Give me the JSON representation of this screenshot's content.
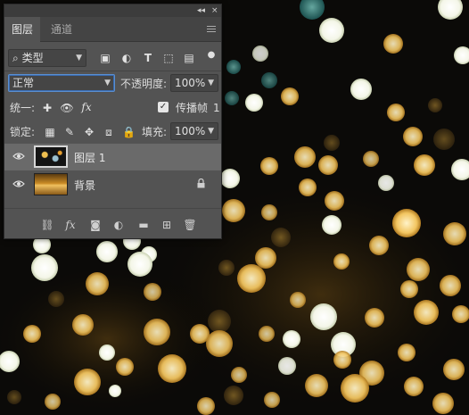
{
  "panel": {
    "collapse_icon": "collapse-double-arrow-icon",
    "close_label": "×",
    "tabs": [
      {
        "label": "图层",
        "active": true
      },
      {
        "label": "通道",
        "active": false
      }
    ]
  },
  "filter": {
    "kind_label": "类型",
    "icons": [
      "pixel-filter-icon",
      "adjustment-filter-icon",
      "type-filter-icon",
      "shape-filter-icon",
      "smart-object-filter-icon",
      "filter-toggle-icon"
    ]
  },
  "blend": {
    "mode": "正常",
    "opacity_label": "不透明度:",
    "opacity_value": "100%"
  },
  "unify": {
    "label": "统一:",
    "icons": [
      "unify-position-icon",
      "unify-visibility-icon",
      "unify-style-icon"
    ],
    "propagate_label": "传播帧",
    "propagate_value": "1",
    "propagate_checked": true
  },
  "lock": {
    "label": "锁定:",
    "icons": [
      "lock-transparent-pixels-icon",
      "lock-image-pixels-icon",
      "lock-position-icon",
      "lock-artboard-icon",
      "lock-all-icon"
    ],
    "fill_label": "填充:",
    "fill_value": "100%"
  },
  "layers": [
    {
      "name": "图层 1",
      "visible": true,
      "selected": true,
      "locked": false
    },
    {
      "name": "背景",
      "visible": true,
      "selected": false,
      "locked": true
    }
  ],
  "bottom_icons": [
    "link-layers-icon",
    "layer-style-icon",
    "add-mask-icon",
    "adjustment-layer-icon",
    "new-group-icon",
    "new-layer-icon",
    "delete-layer-icon"
  ],
  "colors": {
    "panel_bg": "#535353",
    "selected_layer": "#6a6a6a",
    "canvas_bg": "#0b0a08"
  }
}
